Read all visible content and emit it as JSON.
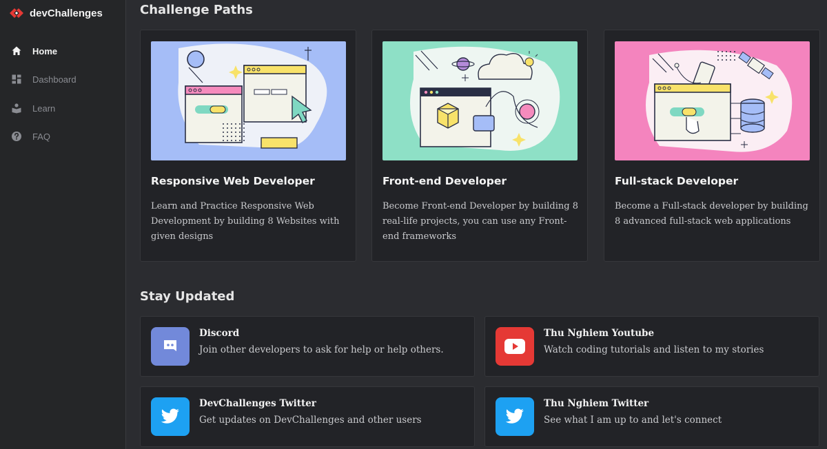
{
  "app": {
    "brand": "devChallenges",
    "accent": "#e53935"
  },
  "sidebar": {
    "items": [
      {
        "label": "Home",
        "icon": "home-icon",
        "active": true
      },
      {
        "label": "Dashboard",
        "icon": "dashboard-icon",
        "active": false
      },
      {
        "label": "Learn",
        "icon": "learn-icon",
        "active": false
      },
      {
        "label": "FAQ",
        "icon": "help-icon",
        "active": false
      }
    ]
  },
  "paths": {
    "heading": "Challenge Paths",
    "cards": [
      {
        "title": "Responsive Web Developer",
        "description": "Learn and Practice Responsive Web Development by building 8 Websites with given designs",
        "bg": "#a5bdf7"
      },
      {
        "title": "Front-end Developer",
        "description": "Become Front-end Developer by building 8 real-life projects, you can use any Front-end frameworks",
        "bg": "#8ee0c6"
      },
      {
        "title": "Full-stack Developer",
        "description": "Become a Full-stack developer by building 8 advanced full-stack web applications",
        "bg": "#f484be"
      }
    ]
  },
  "updates": {
    "heading": "Stay Updated",
    "cards": [
      {
        "title": "Discord",
        "description": "Join other developers to ask for help or help others.",
        "icon": "discord-icon",
        "color": "#7289da"
      },
      {
        "title": "Thu Nghiem Youtube",
        "description": "Watch coding tutorials and listen to my stories",
        "icon": "youtube-icon",
        "color": "#e53935"
      },
      {
        "title": "DevChallenges Twitter",
        "description": "Get updates on DevChallenges and other users",
        "icon": "twitter-icon",
        "color": "#1da1f2"
      },
      {
        "title": "Thu Nghiem Twitter",
        "description": "See what I am up to and let's connect",
        "icon": "twitter-icon",
        "color": "#1da1f2"
      }
    ]
  }
}
